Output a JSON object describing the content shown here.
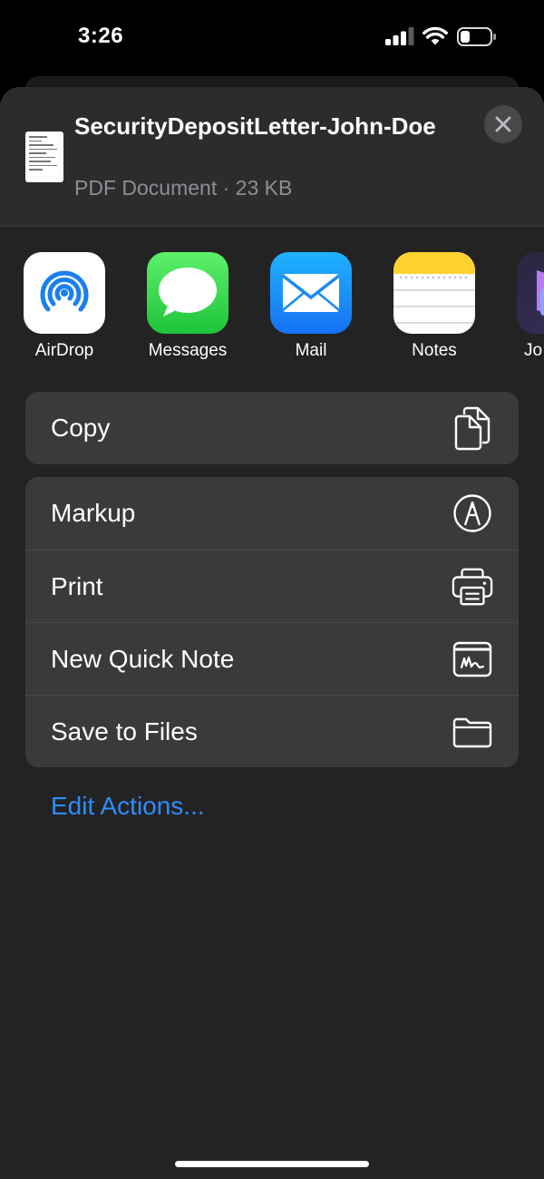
{
  "status_bar": {
    "time": "3:26"
  },
  "share_sheet": {
    "document": {
      "title": "SecurityDepositLetter-John-Doe",
      "subtitle": "PDF Document · 23 KB"
    },
    "apps": [
      {
        "label": "AirDrop",
        "icon": "airdrop-icon"
      },
      {
        "label": "Messages",
        "icon": "messages-icon"
      },
      {
        "label": "Mail",
        "icon": "mail-icon"
      },
      {
        "label": "Notes",
        "icon": "notes-icon"
      },
      {
        "label": "Jo",
        "icon": "journal-icon"
      }
    ],
    "actions_primary": [
      {
        "label": "Copy",
        "icon": "copy-icon"
      }
    ],
    "actions_secondary": [
      {
        "label": "Markup",
        "icon": "markup-icon"
      },
      {
        "label": "Print",
        "icon": "print-icon"
      },
      {
        "label": "New Quick Note",
        "icon": "quick-note-icon"
      },
      {
        "label": "Save to Files",
        "icon": "folder-icon"
      }
    ],
    "edit_actions_label": "Edit Actions..."
  },
  "colors": {
    "accent": "#2f8cff",
    "sheet_bg": "#232324",
    "row_bg": "#3a3a3c"
  }
}
